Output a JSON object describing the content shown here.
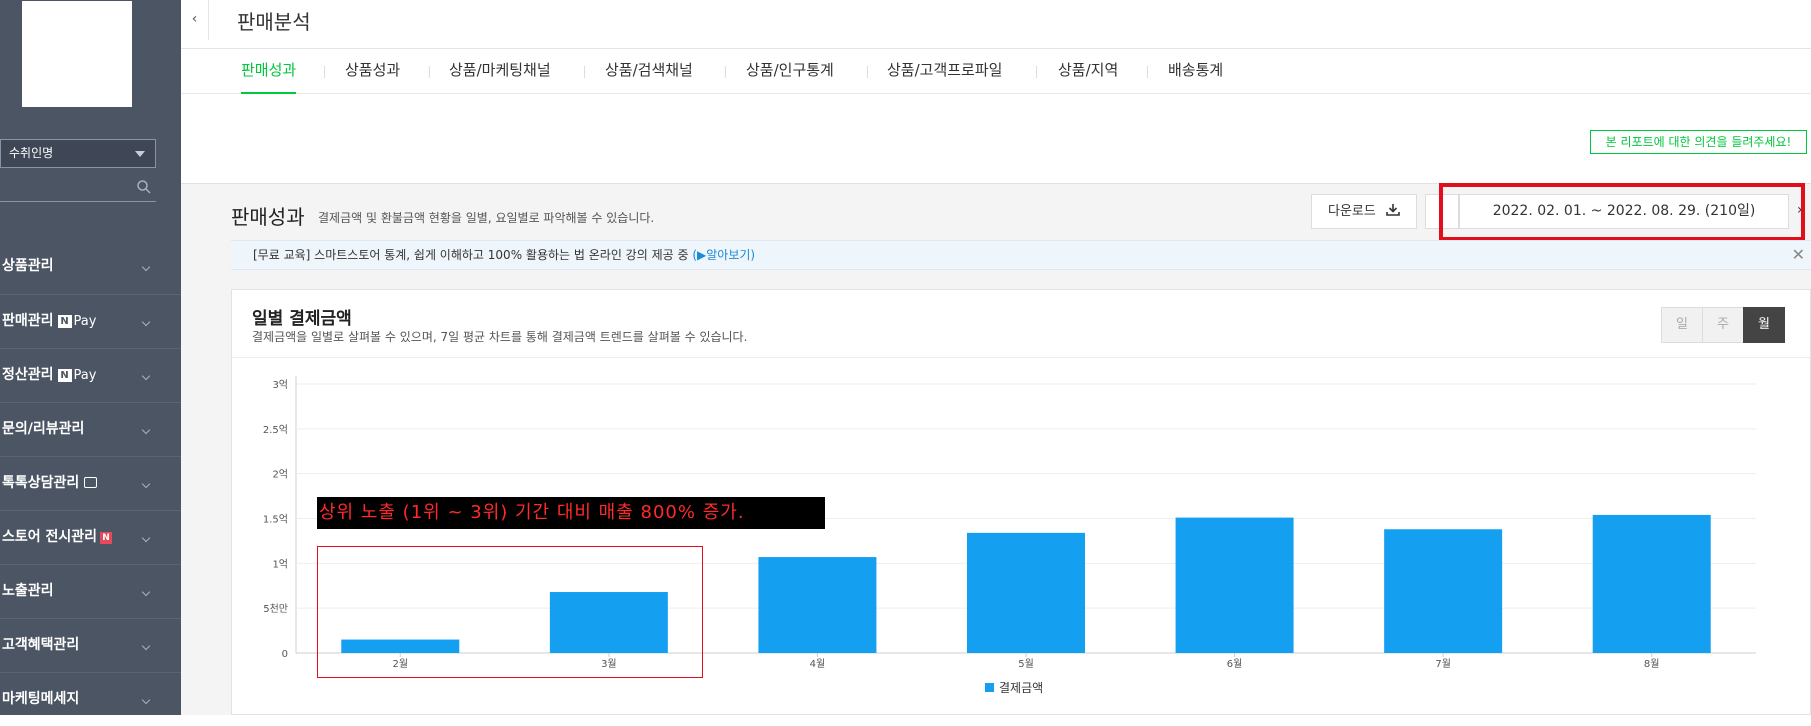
{
  "sidebar": {
    "store_select": "수취인명",
    "menu": [
      {
        "label": "상품관리"
      },
      {
        "label": "판매관리",
        "badge": "N",
        "badge_text": "Pay"
      },
      {
        "label": "정산관리",
        "badge": "N",
        "badge_text": "Pay"
      },
      {
        "label": "문의/리뷰관리"
      },
      {
        "label": "톡톡상담관리"
      },
      {
        "label": "스토어 전시관리",
        "new_badge": "N"
      },
      {
        "label": "노출관리"
      },
      {
        "label": "고객혜택관리"
      },
      {
        "label": "마케팅메세지"
      }
    ]
  },
  "header": {
    "collapse_glyph": "‹",
    "title": "판매분석"
  },
  "tabs": [
    {
      "label": "판매성과",
      "active": true
    },
    {
      "label": "상품성과"
    },
    {
      "label": "상품/마케팅채널"
    },
    {
      "label": "상품/검색채널"
    },
    {
      "label": "상품/인구통계"
    },
    {
      "label": "상품/고객프로파일"
    },
    {
      "label": "상품/지역"
    },
    {
      "label": "배송통계"
    }
  ],
  "feedback_label": "본 리포트에 대한 의견을 들려주세요!",
  "section": {
    "title": "판매성과",
    "description": "결제금액 및 환불금액 현황을 일별, 요일별로 파악해볼 수 있습니다.",
    "download_label": "다운로드",
    "date_range": "2022. 02. 01. ~ 2022. 08. 29. (210일)",
    "next_glyph": "›"
  },
  "notice": {
    "text": "[무료 교육] 스마트스토어 통계, 쉽게 이해하고 100% 활용하는 법 온라인 강의 제공 중 ",
    "link": "(▶알아보기)",
    "close": "✕"
  },
  "card": {
    "title": "일별 결제금액",
    "description": "결제금액을 일별로 살펴볼 수 있으며, 7일 평균 차트를 통해 결제금액 트렌드를 살펴볼 수 있습니다.",
    "period_buttons": [
      "일",
      "주",
      "월"
    ],
    "period_active": "월"
  },
  "annotation": "상위 노출 (1위 ~ 3위) 기간 대비 매출 800% 증가.",
  "colors": {
    "accent_green": "#00c73c",
    "bar_blue": "#159ff1",
    "highlight_red": "#e30e1c",
    "sidebar_bg": "#4c5564"
  },
  "chart_data": {
    "type": "bar",
    "categories": [
      "2월",
      "3월",
      "4월",
      "5월",
      "6월",
      "7월",
      "8월"
    ],
    "series": [
      {
        "name": "결제금액",
        "values": [
          15000000,
          68000000,
          107000000,
          134000000,
          151000000,
          138000000,
          154000000
        ]
      }
    ],
    "ylim": [
      0,
      300000000
    ],
    "yticks": [
      {
        "value": 0,
        "label": "0"
      },
      {
        "value": 50000000,
        "label": "5천만"
      },
      {
        "value": 100000000,
        "label": "1억"
      },
      {
        "value": 150000000,
        "label": "1.5억"
      },
      {
        "value": 200000000,
        "label": "2억"
      },
      {
        "value": 250000000,
        "label": "2.5억"
      },
      {
        "value": 300000000,
        "label": "3억"
      }
    ],
    "grid": true,
    "legend": "bottom-center"
  }
}
